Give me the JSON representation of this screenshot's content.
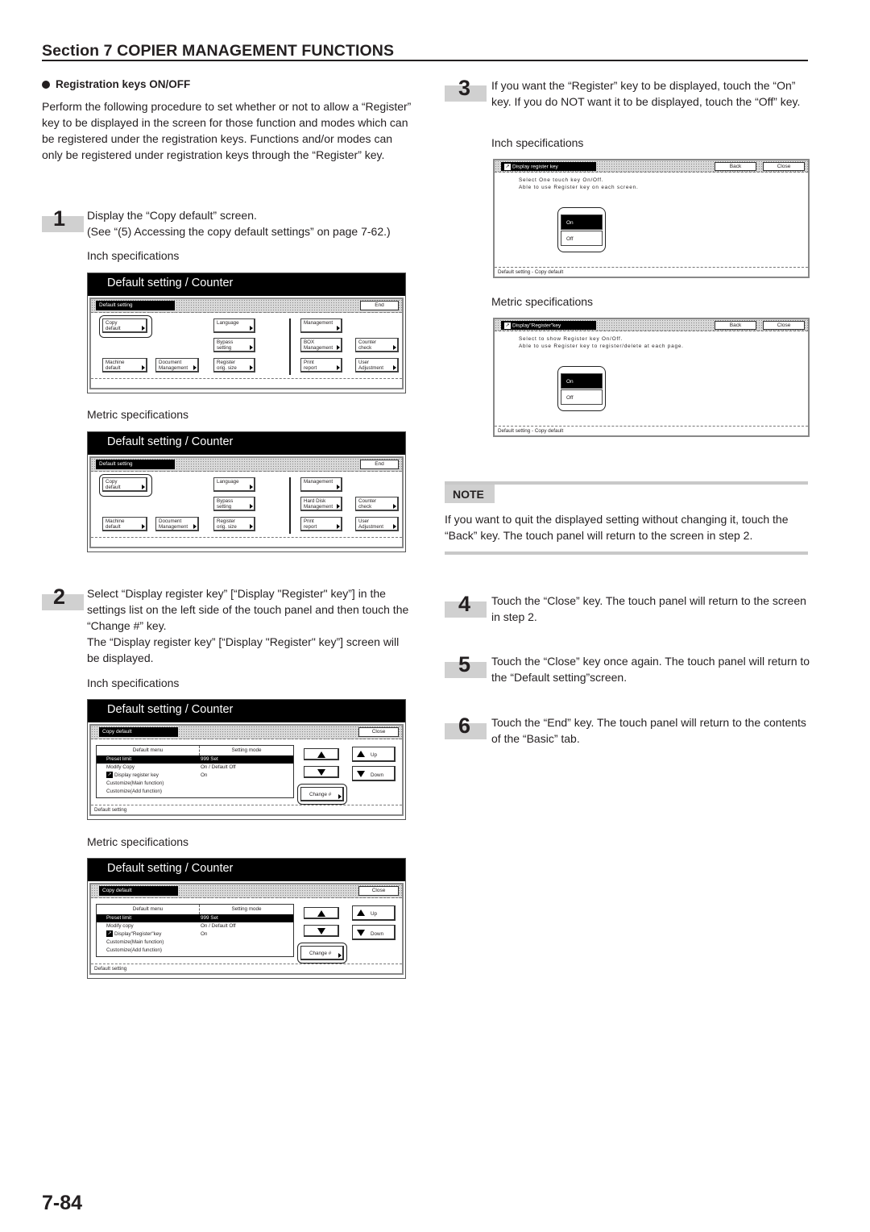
{
  "header": {
    "section_title": "Section 7  COPIER MANAGEMENT FUNCTIONS"
  },
  "topic": {
    "title": "Registration keys ON/OFF",
    "intro": "Perform the following procedure to set whether or not to allow a “Register” key to be displayed in the screen for those function and modes which can be registered under the registration keys. Functions and/or modes can only be registered under registration keys through the “Register” key."
  },
  "steps": [
    {
      "num": "1",
      "lines": [
        "Display the “Copy default” screen.",
        "(See “(5) Accessing the copy default settings” on page 7-62.)"
      ]
    },
    {
      "num": "2",
      "lines": [
        "Select “Display register key” [“Display \"Register\" key”] in the settings list on the left side of the touch panel and then touch the “Change #” key.",
        "The “Display register key” [“Display \"Register\" key”] screen will be displayed."
      ]
    },
    {
      "num": "3",
      "lines": [
        "If you want the “Register” key to be displayed, touch the “On” key. If you do NOT want it to be displayed, touch the “Off” key."
      ]
    },
    {
      "num": "4",
      "lines": [
        "Touch the “Close” key. The touch panel will return to the screen in step 2."
      ]
    },
    {
      "num": "5",
      "lines": [
        "Touch the “Close” key once again. The touch panel will return to the “Default setting”screen."
      ]
    },
    {
      "num": "6",
      "lines": [
        "Touch the “End” key. The touch panel will return to the contents of the “Basic” tab."
      ]
    }
  ],
  "specs": {
    "inch": "Inch specifications",
    "metric": "Metric specifications"
  },
  "default_screens": [
    {
      "head": "Default setting / Counter",
      "title": "Default setting",
      "end": "End",
      "keys": {
        "copy_default": [
          "Copy",
          "default"
        ],
        "machine_default": [
          "Machine",
          "default"
        ],
        "document_management": [
          "Document",
          "Management"
        ],
        "language": [
          "Language",
          ""
        ],
        "bypass": [
          "Bypass",
          "setting"
        ],
        "register_size": [
          "Register",
          "orig. size"
        ],
        "management": [
          "Management",
          ""
        ],
        "storage": [
          "BOX",
          "Management"
        ],
        "print_report": [
          "Print",
          "report"
        ],
        "counter_check": [
          "Counter",
          "check"
        ],
        "user_adjustment": [
          "User",
          "Adjustment"
        ]
      }
    },
    {
      "head": "Default setting / Counter",
      "title": "Default setting",
      "end": "End",
      "keys": {
        "copy_default": [
          "Copy",
          "default"
        ],
        "machine_default": [
          "Machine",
          "default"
        ],
        "document_management": [
          "Document",
          "Management"
        ],
        "language": [
          "Language",
          ""
        ],
        "bypass": [
          "Bypass",
          "setting"
        ],
        "register_size": [
          "Register",
          "orig. size"
        ],
        "management": [
          "Management",
          ""
        ],
        "storage": [
          "Hard Disk",
          "Management"
        ],
        "print_report": [
          "Print",
          "report"
        ],
        "counter_check": [
          "Counter",
          "check"
        ],
        "user_adjustment": [
          "User",
          "Adjustment"
        ]
      }
    }
  ],
  "copy_screens": [
    {
      "head": "Default setting / Counter",
      "title": "Copy default",
      "close": "Close",
      "col1": "Default menu",
      "col2": "Setting mode",
      "rows": [
        {
          "name": "Preset limit",
          "value": "999 Set",
          "selected": true
        },
        {
          "name": "Modify Copy",
          "value": "On / Default Off"
        },
        {
          "name": "Display register key",
          "value": "On",
          "icon": true
        },
        {
          "name": "Customize(Main function)",
          "value": ""
        },
        {
          "name": "Customize(Add function)",
          "value": ""
        }
      ],
      "up": "Up",
      "down": "Down",
      "change": "Change #",
      "footer": "Default setting"
    },
    {
      "head": "Default setting / Counter",
      "title": "Copy default",
      "close": "Close",
      "col1": "Default menu",
      "col2": "Setting mode",
      "rows": [
        {
          "name": "Preset limit",
          "value": "999 Set",
          "selected": true
        },
        {
          "name": "Modify copy",
          "value": "On / Default Off"
        },
        {
          "name": "Display\"Register\"key",
          "value": "On",
          "icon": true
        },
        {
          "name": "Customize(Main function)",
          "value": ""
        },
        {
          "name": "Customize(Add function)",
          "value": ""
        }
      ],
      "up": "Up",
      "down": "Down",
      "change": "Change #",
      "footer": "Default setting"
    }
  ],
  "onoff_screens": [
    {
      "title": "Display register key",
      "back": "Back",
      "close": "Close",
      "desc": [
        "Select One touch key On/Off.",
        "Able to use Register key on each screen."
      ],
      "on": "On",
      "off": "Off",
      "selected": "On",
      "footer": "Default setting - Copy default"
    },
    {
      "title": "Display\"Register\"key",
      "back": "Back",
      "close": "Close",
      "desc": [
        "Select to show Register key On/Off.",
        "Able to use Register key to register/delete at each page."
      ],
      "on": "On",
      "off": "Off",
      "selected": "On",
      "footer": "Default setting - Copy default"
    }
  ],
  "note": {
    "label": "NOTE",
    "text": "If you want to quit the displayed setting without changing it, touch the “Back” key. The touch panel will return to the screen in step 2."
  },
  "page_number": "7-84"
}
